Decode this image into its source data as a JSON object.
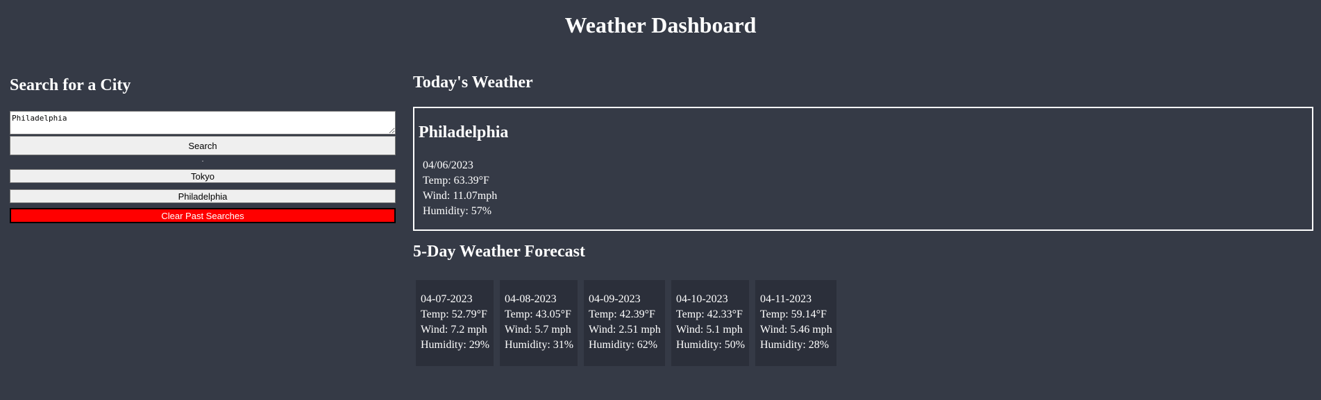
{
  "title": "Weather Dashboard",
  "search": {
    "heading": "Search for a City",
    "input_value": "Philadelphia",
    "search_label": "Search",
    "separator": ".",
    "history": [
      "Tokyo",
      "Philadelphia"
    ],
    "clear_label": "Clear Past Searches"
  },
  "today": {
    "heading": "Today's Weather",
    "city": "Philadelphia",
    "date": "04/06/2023",
    "temp": "Temp: 63.39°F",
    "wind": "Wind: 11.07mph",
    "humidity": "Humidity: 57%"
  },
  "forecast": {
    "heading": "5-Day Weather Forecast",
    "days": [
      {
        "date": "04-07-2023",
        "temp": "Temp: 52.79°F",
        "wind": "Wind: 7.2 mph",
        "humidity": "Humidity: 29%"
      },
      {
        "date": "04-08-2023",
        "temp": "Temp: 43.05°F",
        "wind": "Wind: 5.7 mph",
        "humidity": "Humidity: 31%"
      },
      {
        "date": "04-09-2023",
        "temp": "Temp: 42.39°F",
        "wind": "Wind: 2.51 mph",
        "humidity": "Humidity: 62%"
      },
      {
        "date": "04-10-2023",
        "temp": "Temp: 42.33°F",
        "wind": "Wind: 5.1 mph",
        "humidity": "Humidity: 50%"
      },
      {
        "date": "04-11-2023",
        "temp": "Temp: 59.14°F",
        "wind": "Wind: 5.46 mph",
        "humidity": "Humidity: 28%"
      }
    ]
  },
  "colors": {
    "background": "#353a46",
    "card_background": "#2b2f3a",
    "clear_button": "#ff0000"
  }
}
